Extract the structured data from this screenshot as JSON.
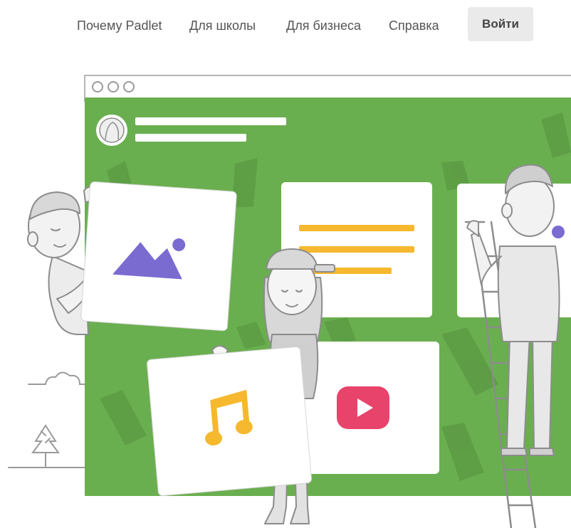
{
  "nav": {
    "items": [
      {
        "label": "Почему Padlet"
      },
      {
        "label": "Для школы"
      },
      {
        "label": "Для бизнеса"
      },
      {
        "label": "Справка"
      }
    ],
    "login_label": "Войти"
  },
  "hero": {
    "colors": {
      "board_green": "#6aaf4f",
      "board_green_dark": "#5d9c44",
      "card_white": "#ffffff",
      "accent_yellow": "#f5b82e",
      "accent_purple": "#7a6bd1",
      "accent_red": "#e8436b",
      "line_gray": "#888888"
    },
    "icons": [
      "image-icon",
      "music-note-icon",
      "play-video-icon",
      "avatar-icon"
    ]
  }
}
